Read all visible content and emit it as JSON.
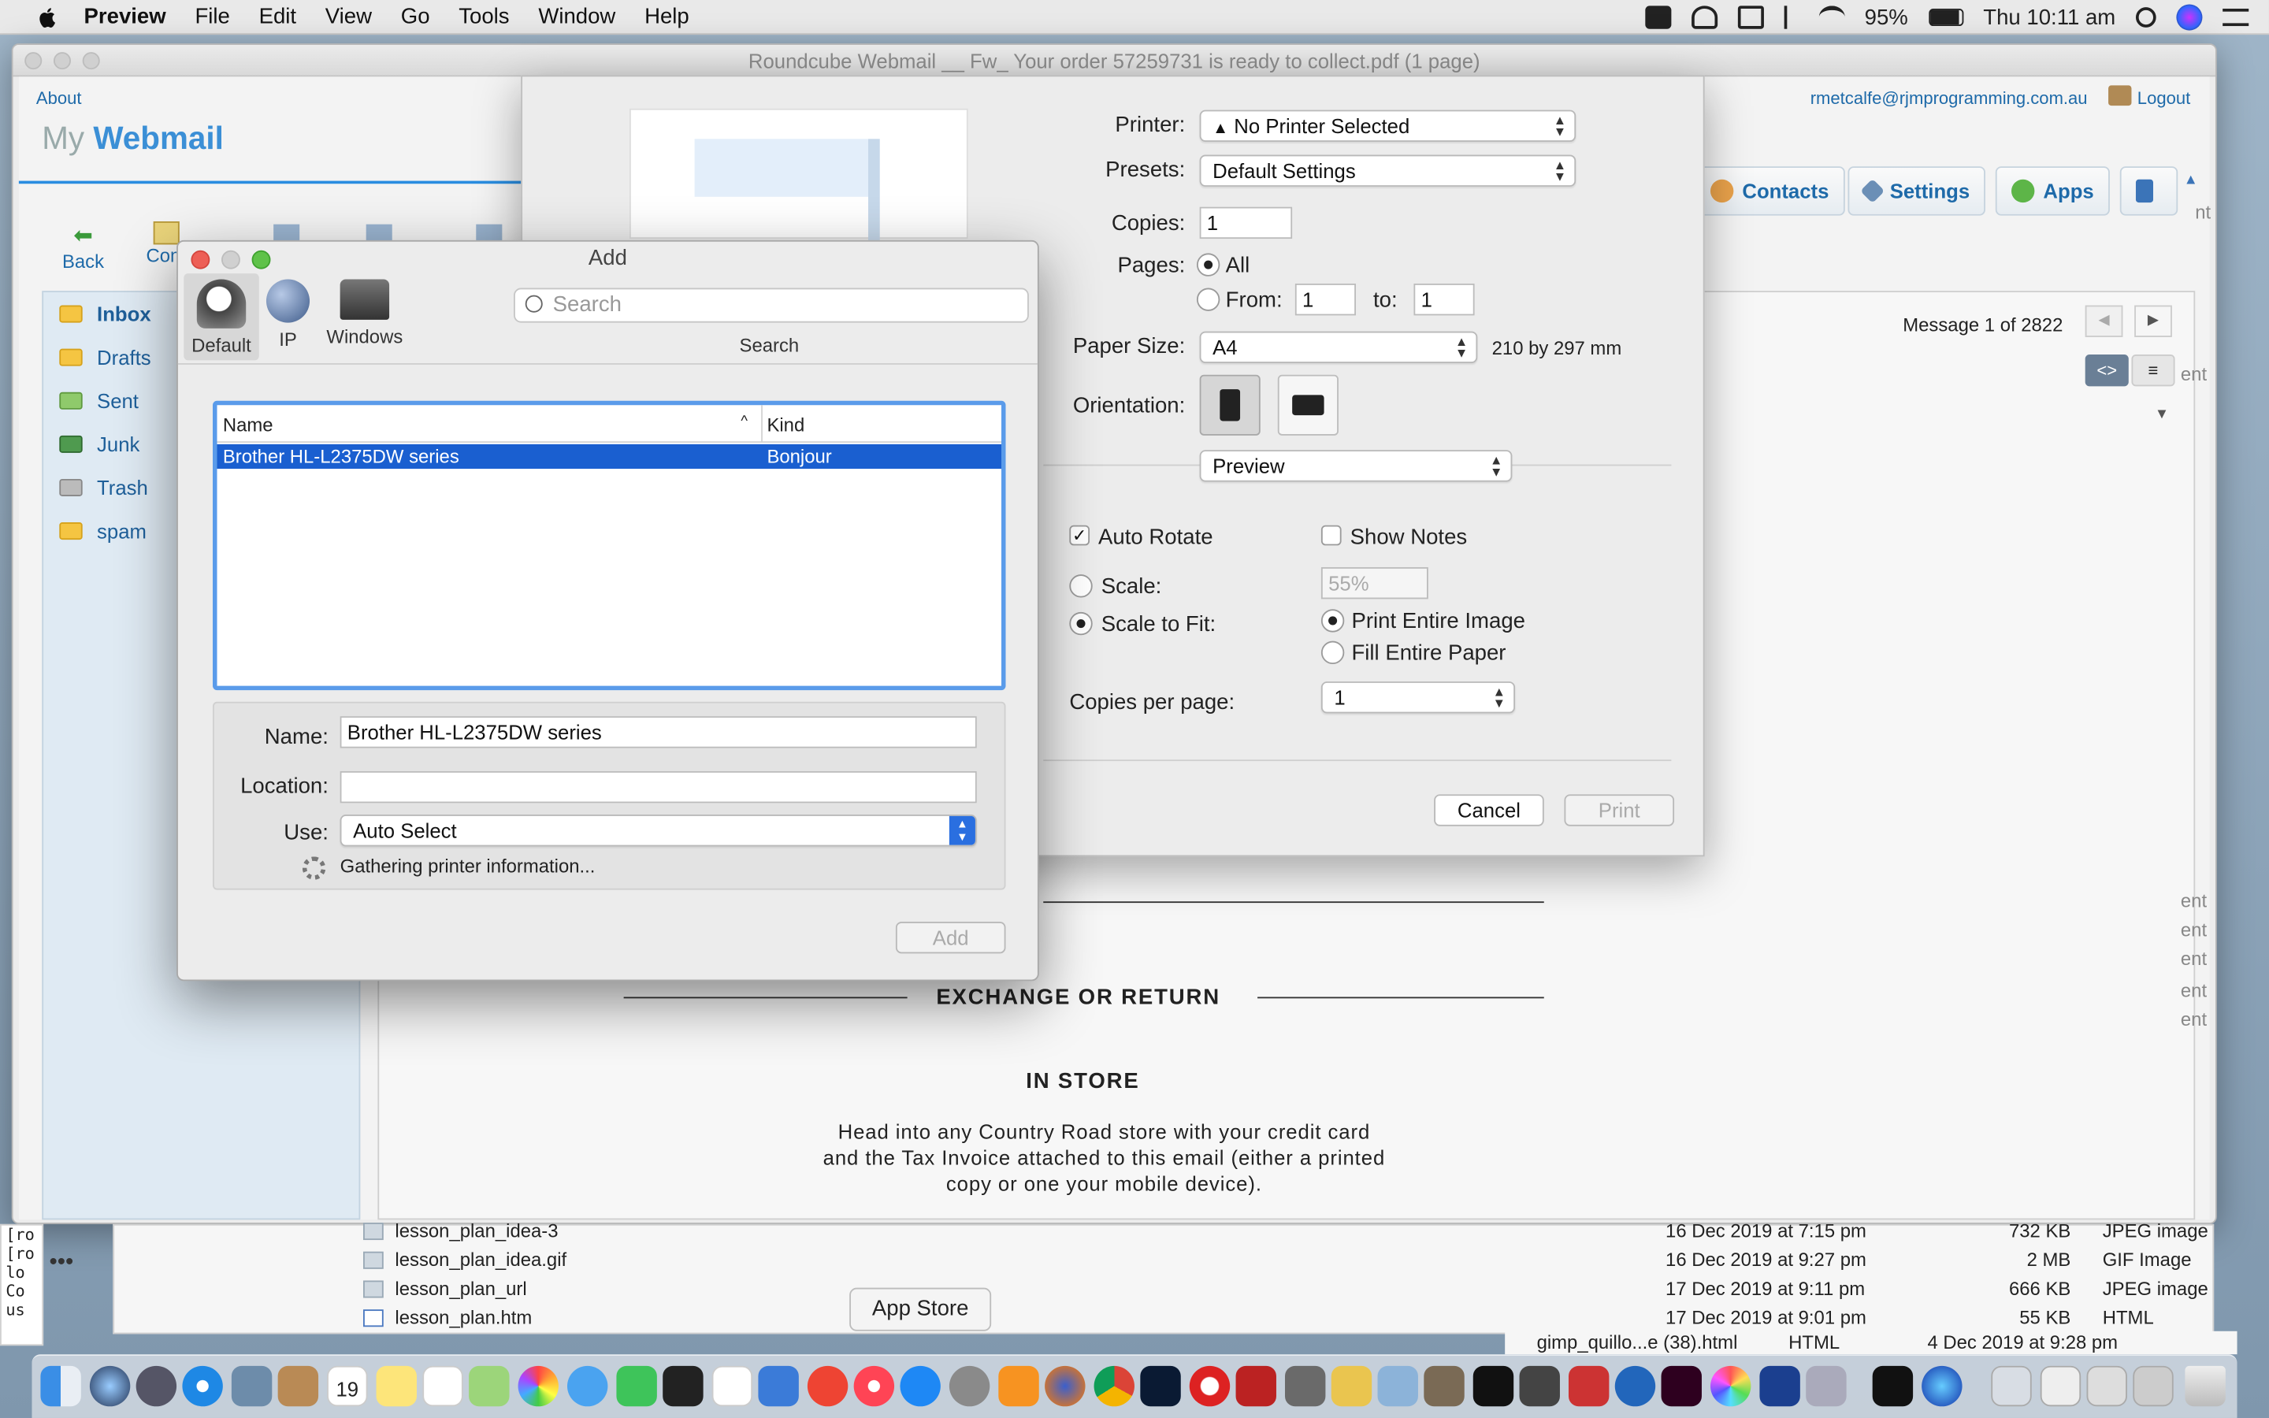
{
  "menubar": {
    "app": "Preview",
    "items": [
      "File",
      "Edit",
      "View",
      "Go",
      "Tools",
      "Window",
      "Help"
    ],
    "battery": "95%",
    "clock": "Thu 10:11 am"
  },
  "window": {
    "title": "Roundcube Webmail __ Fw_ Your order 57259731 is ready to collect.pdf (1 page)"
  },
  "webmail": {
    "about": "About",
    "logo_my": "My",
    "logo_webmail": "Webmail",
    "user": "rmetcalfe@rjmprogramming.com.au",
    "logout": "Logout",
    "nav": {
      "contacts": "Contacts",
      "settings": "Settings",
      "apps": "Apps"
    },
    "toolbar": {
      "back": "Back",
      "compose": "Com"
    },
    "folders": [
      "Inbox",
      "Drafts",
      "Sent",
      "Junk",
      "Trash",
      "spam"
    ],
    "message_count": "Message 1 of 2822",
    "body": {
      "heading1": "EXCHANGE OR RETURN",
      "heading2": "IN STORE",
      "line1": "Head into any Country Road store with your credit card",
      "line2": "and the Tax Invoice attached to this email (either a printed",
      "line3": "copy or one your mobile device)."
    },
    "right_snippets": [
      "nt",
      "ent",
      "ent",
      "ent",
      "ent",
      "ent",
      "ent"
    ]
  },
  "print": {
    "printer_label": "Printer:",
    "printer_value": "No Printer Selected",
    "presets_label": "Presets:",
    "presets_value": "Default Settings",
    "copies_label": "Copies:",
    "copies_value": "1",
    "pages_label": "Pages:",
    "pages_all": "All",
    "pages_from": "From:",
    "from_value": "1",
    "pages_to": "to:",
    "to_value": "1",
    "paper_label": "Paper Size:",
    "paper_value": "A4",
    "paper_dims": "210 by 297 mm",
    "orientation_label": "Orientation:",
    "section_value": "Preview",
    "auto_rotate": "Auto Rotate",
    "show_notes": "Show Notes",
    "scale": "Scale:",
    "scale_value": "55%",
    "scale_to_fit": "Scale to Fit:",
    "print_entire": "Print Entire Image",
    "fill_entire": "Fill Entire Paper",
    "copies_per_page_label": "Copies per page:",
    "copies_per_page_value": "1",
    "cancel": "Cancel",
    "print": "Print"
  },
  "add_dialog": {
    "title": "Add",
    "tabs": [
      "Default",
      "IP",
      "Windows"
    ],
    "search_placeholder": "Search",
    "search_label": "Search",
    "col_name": "Name",
    "col_kind": "Kind",
    "row_name": "Brother HL-L2375DW series",
    "row_kind": "Bonjour",
    "name_label": "Name:",
    "name_value": "Brother HL-L2375DW series",
    "location_label": "Location:",
    "location_value": "",
    "use_label": "Use:",
    "use_value": "Auto Select",
    "status": "Gathering printer information...",
    "add_button": "Add"
  },
  "finder": {
    "rows": [
      {
        "name": "lesson_plan_idea-3",
        "date": "16 Dec 2019 at 7:15 pm",
        "size": "732 KB",
        "kind": "JPEG image"
      },
      {
        "name": "lesson_plan_idea.gif",
        "date": "16 Dec 2019 at 9:27 pm",
        "size": "2 MB",
        "kind": "GIF Image"
      },
      {
        "name": "lesson_plan_url",
        "date": "17 Dec 2019 at 9:11 pm",
        "size": "666 KB",
        "kind": "JPEG image"
      },
      {
        "name": "lesson_plan.htm",
        "date": "17 Dec 2019 at 9:01 pm",
        "size": "55 KB",
        "kind": "HTML"
      }
    ],
    "extra_row": {
      "name": "gimp_quillo...e (38).html",
      "kind": "HTML",
      "date": "4 Dec 2019 at 9:28 pm"
    }
  },
  "terminal": {
    "lines": [
      "[ro",
      "[ro",
      "lo",
      "Co",
      "us"
    ]
  },
  "dock": {
    "tooltip": "App Store",
    "calendar_day": "19"
  }
}
